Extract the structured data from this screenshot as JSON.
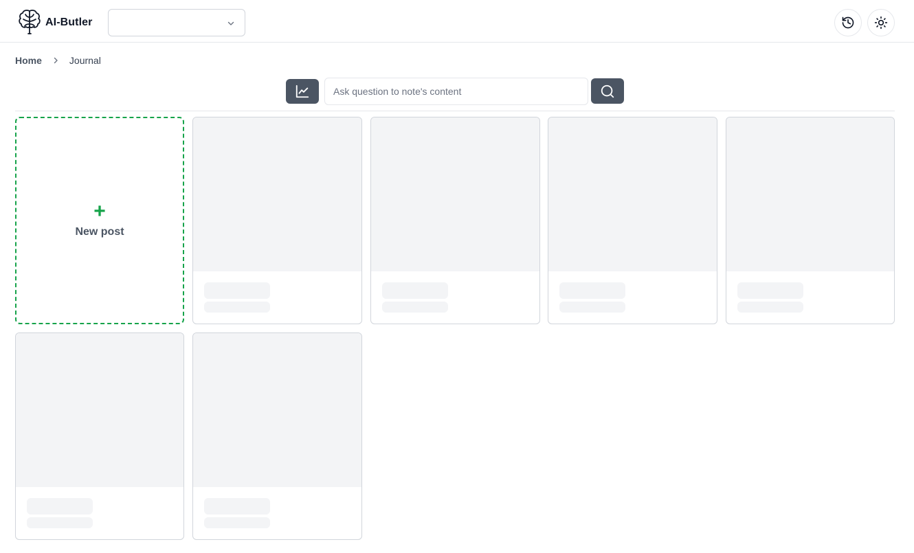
{
  "app": {
    "title": "AI-Butler",
    "logo_icon": "brain-tree-icon"
  },
  "header": {
    "select_value": "",
    "history_icon": "history-icon",
    "theme_icon": "sun-icon"
  },
  "breadcrumb": {
    "home": "Home",
    "current": "Journal"
  },
  "search": {
    "placeholder": "Ask question to note's content",
    "value": "",
    "chart_icon": "chart-line-icon",
    "search_icon": "search-icon"
  },
  "new_post": {
    "plus": "+",
    "label": "New post"
  },
  "cards": [
    {
      "state": "loading"
    },
    {
      "state": "loading"
    },
    {
      "state": "loading"
    },
    {
      "state": "loading"
    },
    {
      "state": "loading"
    },
    {
      "state": "loading"
    }
  ],
  "colors": {
    "accent": "#16a34a",
    "button_dark": "#4b5563",
    "skeleton": "#f3f4f6",
    "border": "#d1d5db"
  }
}
